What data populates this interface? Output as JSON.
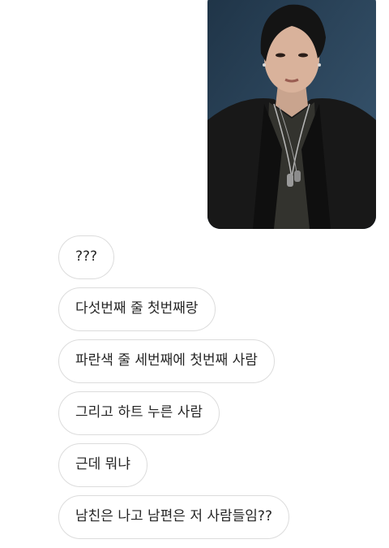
{
  "conversation": {
    "photo": {
      "icon": "person-photo-icon"
    },
    "messages": [
      {
        "text": "???"
      },
      {
        "text": "다섯번째 줄 첫번째랑"
      },
      {
        "text": "파란색 줄 세번째에 첫번째 사람"
      },
      {
        "text": "그리고 하트 누른 사람"
      },
      {
        "text": "근데 뭐냐"
      },
      {
        "text": "남친은 나고 남편은 저 사람들임??"
      }
    ]
  }
}
